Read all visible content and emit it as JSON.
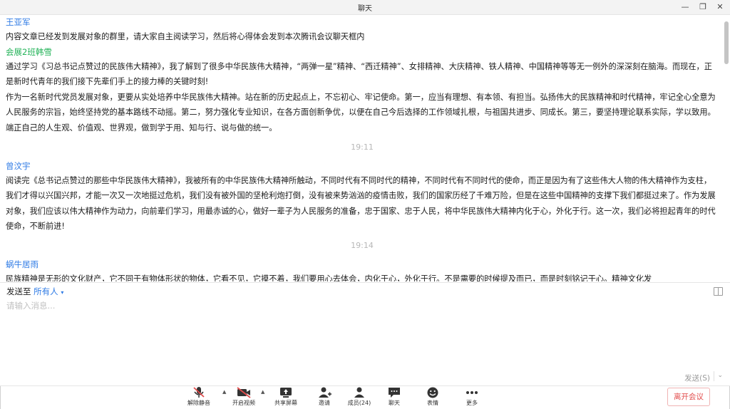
{
  "window": {
    "title": "聊天",
    "minimize": "—",
    "restore": "❐",
    "close": "✕"
  },
  "messages": [
    {
      "type": "message",
      "sender": "王亚军",
      "sender_color": "#2f7be5",
      "paragraphs": [
        "内容文章已经发到发展对象的群里，请大家自主阅读学习，然后将心得体会发到本次腾讯会议聊天框内"
      ]
    },
    {
      "type": "message",
      "sender": "会展2班韩雪",
      "sender_color": "#25b35a",
      "paragraphs": [
        "通过学习《习总书记点赞过的民族伟大精神》，我了解到了很多中华民族伟大精神，“两弹一星”精神、“西迁精神”、女排精神、大庆精神、铁人精神、中国精神等等无一例外的深深刻在脑海。而现在，正是新时代青年的我们接下先辈们手上的接力棒的关键时刻!",
        "作为一名新时代党员发展对象，更要从实处培养中华民族伟大精神。站在新的历史起点上，不忘初心、牢记使命。第一，应当有理想、有本领、有担当。弘扬伟大的民族精神和时代精神，牢记全心全意为人民服务的宗旨，始终坚持党的基本路线不动摇。第二，努力强化专业知识，在各方面创新争优，以便在自己今后选择的工作领域扎根，与祖国共进步、同成长。第三，要坚持理论联系实际，学以致用。端正自己的人生观、价值观、世界观，做到学于用、知与行、说与做的统一。"
      ]
    },
    {
      "type": "timestamp",
      "text": "19:11"
    },
    {
      "type": "message",
      "sender": "曾汶宇",
      "sender_color": "#2f7be5",
      "paragraphs": [
        "阅读完《总书记点赞过的那些中华民族伟大精神》，我被所有的中华民族伟大精神所触动，不同时代有不同时代的精神，不同时代有不同时代的使命，而正是因为有了这些伟大人物的伟大精神作为支柱，我们才得以兴国兴邦，才能一次又一次地挺过危机，我们没有被外国的坚枪利炮打倒，没有被来势汹汹的疫情击败，我们的国家历经了千难万险，但是在这些中国精神的支撑下我们都挺过来了。作为发展对象，我们应该以伟大精神作为动力，向前辈们学习，用最赤诚的心，做好一辈子为人民服务的准备，忠于国家、忠于人民，将中华民族伟大精神内化于心，外化于行。这一次，我们必将担起青年的时代使命，不断前进!"
      ]
    },
    {
      "type": "timestamp",
      "text": "19:14"
    },
    {
      "type": "message",
      "sender": "蜗牛居雨",
      "sender_color": "#2f7be5",
      "paragraphs": [
        "民族精神是无形的文化财产，它不同于有物体形状的物体，它看不见，它摸不着，我们要用心去体会，内化于心，外化于行。不是需要的时候提及而已，而是时刻铭记于心。精神文化发"
      ]
    }
  ],
  "composer": {
    "send_to_label": "发送至",
    "recipient": "所有人",
    "recipient_caret": "▾",
    "placeholder": "请输入消息...",
    "send_label": "发送(S)",
    "send_caret": "⌄"
  },
  "toolbar": {
    "items": [
      {
        "key": "unmute",
        "label": "解除静音",
        "icon": "mic-muted-icon"
      },
      {
        "key": "video",
        "label": "开启视频",
        "icon": "camera-off-icon"
      },
      {
        "key": "share",
        "label": "共享屏幕",
        "icon": "share-screen-icon"
      },
      {
        "key": "invite",
        "label": "邀请",
        "icon": "invite-icon"
      },
      {
        "key": "members",
        "label": "成员(24)",
        "icon": "members-icon"
      },
      {
        "key": "chat",
        "label": "聊天",
        "icon": "chat-icon"
      },
      {
        "key": "emoji",
        "label": "表情",
        "icon": "emoji-icon"
      },
      {
        "key": "more",
        "label": "更多",
        "icon": "more-icon"
      }
    ],
    "leave_label": "离开会议",
    "accent_red": "#e24c4c",
    "accent_blue": "#2f7be5"
  }
}
